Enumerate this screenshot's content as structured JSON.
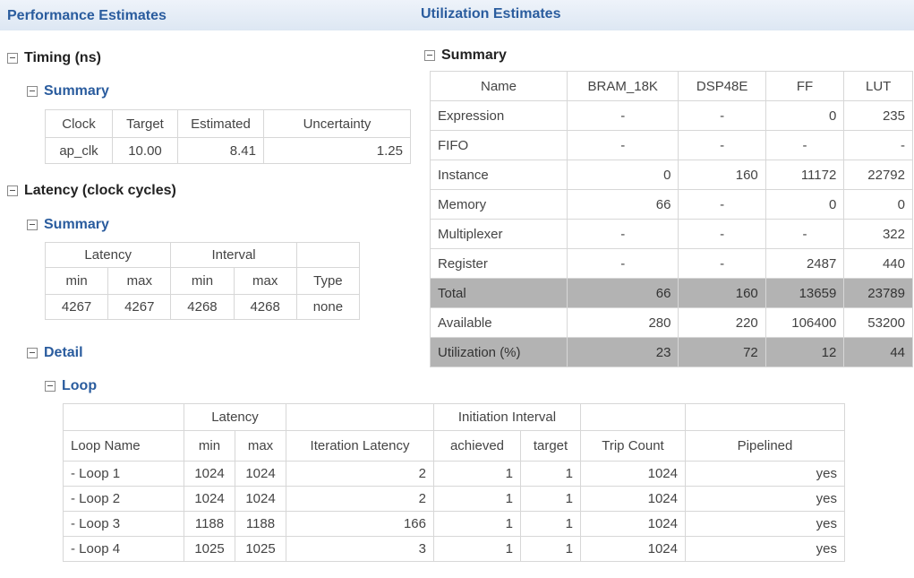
{
  "performance": {
    "header": "Performance Estimates",
    "timing_title": "Timing (ns)",
    "timing_summary_title": "Summary",
    "timing_columns": [
      "Clock",
      "Target",
      "Estimated",
      "Uncertainty"
    ],
    "timing_row": [
      "ap_clk",
      "10.00",
      "8.41",
      "1.25"
    ],
    "latency_title": "Latency (clock cycles)",
    "latency_summary_title": "Summary",
    "latency_group_headers": [
      "Latency",
      "Interval"
    ],
    "latency_columns": [
      "min",
      "max",
      "min",
      "max",
      "Type"
    ],
    "latency_row": [
      "4267",
      "4267",
      "4268",
      "4268",
      "none"
    ],
    "detail_title": "Detail",
    "loop_title": "Loop",
    "loop_group_headers": [
      "Latency",
      "Initiation Interval"
    ],
    "loop_columns": [
      "Loop Name",
      "min",
      "max",
      "Iteration Latency",
      "achieved",
      "target",
      "Trip Count",
      "Pipelined"
    ],
    "loop_rows": [
      [
        "- Loop 1",
        "1024",
        "1024",
        "2",
        "1",
        "1",
        "1024",
        "yes"
      ],
      [
        "- Loop 2",
        "1024",
        "1024",
        "2",
        "1",
        "1",
        "1024",
        "yes"
      ],
      [
        "- Loop 3",
        "1188",
        "1188",
        "166",
        "1",
        "1",
        "1024",
        "yes"
      ],
      [
        "- Loop 4",
        "1025",
        "1025",
        "3",
        "1",
        "1",
        "1024",
        "yes"
      ]
    ]
  },
  "utilization": {
    "header": "Utilization Estimates",
    "summary_title": "Summary",
    "columns": [
      "Name",
      "BRAM_18K",
      "DSP48E",
      "FF",
      "LUT"
    ],
    "rows": [
      [
        "Expression",
        "-",
        "-",
        "0",
        "235"
      ],
      [
        "FIFO",
        "-",
        "-",
        "-",
        "-"
      ],
      [
        "Instance",
        "0",
        "160",
        "11172",
        "22792"
      ],
      [
        "Memory",
        "66",
        "-",
        "0",
        "0"
      ],
      [
        "Multiplexer",
        "-",
        "-",
        "-",
        "322"
      ],
      [
        "Register",
        "-",
        "-",
        "2487",
        "440"
      ],
      [
        "Total",
        "66",
        "160",
        "13659",
        "23789"
      ],
      [
        "Available",
        "280",
        "220",
        "106400",
        "53200"
      ],
      [
        "Utilization (%)",
        "23",
        "72",
        "12",
        "44"
      ]
    ]
  }
}
